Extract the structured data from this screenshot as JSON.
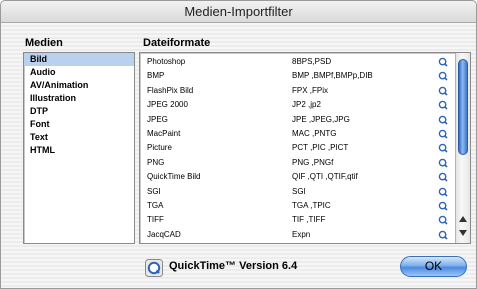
{
  "window": {
    "title": "Medien-Importfilter"
  },
  "media": {
    "header": "Medien",
    "items": [
      {
        "label": "Bild",
        "selected": true
      },
      {
        "label": "Audio"
      },
      {
        "label": "AV/Animation"
      },
      {
        "label": "Illustration"
      },
      {
        "label": "DTP"
      },
      {
        "label": "Font"
      },
      {
        "label": "Text"
      },
      {
        "label": "HTML"
      }
    ]
  },
  "formats": {
    "header": "Dateiformate",
    "rows": [
      {
        "name": "Photoshop",
        "ext": "8BPS,PSD",
        "icon": "quicktime-icon"
      },
      {
        "name": "BMP",
        "ext": "BMP ,BMPf,BMPp,DIB",
        "icon": "quicktime-icon"
      },
      {
        "name": "FlashPix Bild",
        "ext": "FPX ,FPix",
        "icon": "quicktime-icon"
      },
      {
        "name": "JPEG 2000",
        "ext": "JP2 ,jp2",
        "icon": "quicktime-icon"
      },
      {
        "name": "JPEG",
        "ext": "JPE ,JPEG,JPG",
        "icon": "quicktime-icon"
      },
      {
        "name": "MacPaint",
        "ext": "MAC ,PNTG",
        "icon": "quicktime-icon"
      },
      {
        "name": "Picture",
        "ext": "PCT ,PIC ,PICT",
        "icon": "quicktime-icon"
      },
      {
        "name": "PNG",
        "ext": "PNG ,PNGf",
        "icon": "quicktime-icon"
      },
      {
        "name": "QuickTime Bild",
        "ext": "QIF ,QTI ,QTIF,qtif",
        "icon": "quicktime-icon"
      },
      {
        "name": "SGI",
        "ext": "SGI",
        "icon": "quicktime-icon"
      },
      {
        "name": "TGA",
        "ext": "TGA ,TPIC",
        "icon": "quicktime-icon"
      },
      {
        "name": "TIFF",
        "ext": "TIF ,TIFF",
        "icon": "quicktime-icon"
      },
      {
        "name": "JacqCAD",
        "ext": "Expn",
        "icon": "quicktime-icon"
      }
    ]
  },
  "footer": {
    "version": "QuickTime™ Version 6.4",
    "ok_label": "OK"
  },
  "colors": {
    "selection": "#b9d1ee",
    "accent": "#4a8ae0"
  }
}
